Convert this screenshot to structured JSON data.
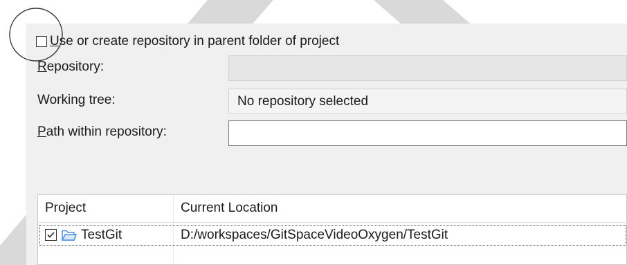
{
  "colors": {
    "panel_bg": "#f0f0f0",
    "decoration": "#d9d9d9",
    "folder_icon": "#4a90d9"
  },
  "use_parent": {
    "checked": false,
    "label_mnemonic": "U",
    "label_rest": "se or create repository in parent folder of project"
  },
  "form": {
    "repository_label_mnemonic": "R",
    "repository_label_rest": "epository:",
    "repository_value": "",
    "working_tree_label": "Working tree:",
    "working_tree_value": "No repository selected",
    "path_label_mnemonic": "P",
    "path_label_rest": "ath within repository:",
    "path_value": ""
  },
  "table": {
    "columns": [
      "Project",
      "Current Location"
    ],
    "rows": [
      {
        "checked": true,
        "icon": "folder-icon",
        "project": "TestGit",
        "location": "D:/workspaces/GitSpaceVideoOxygen/TestGit"
      }
    ]
  }
}
